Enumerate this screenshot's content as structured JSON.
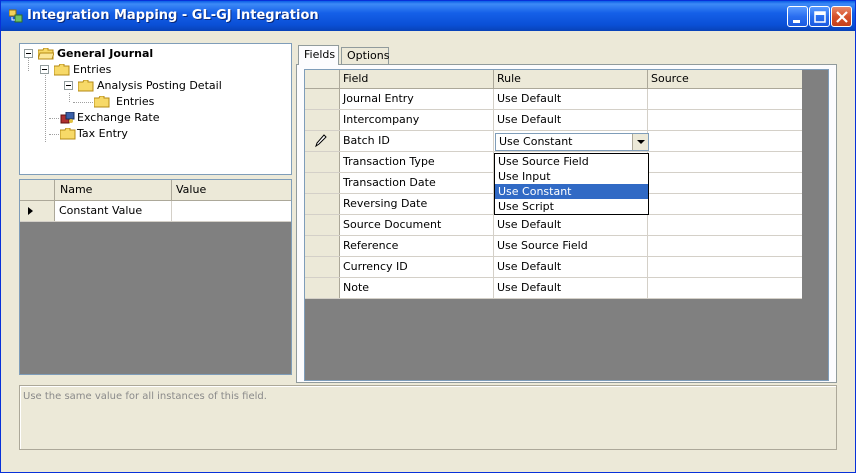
{
  "window": {
    "title": "Integration Mapping - GL-GJ Integration"
  },
  "tree": {
    "nodes": [
      {
        "label": "General Journal",
        "bold": true
      },
      {
        "label": "Entries"
      },
      {
        "label": "Analysis Posting Detail"
      },
      {
        "label": "Entries"
      },
      {
        "label": "Exchange Rate"
      },
      {
        "label": "Tax Entry"
      }
    ]
  },
  "properties": {
    "headers": {
      "name": "Name",
      "value": "Value"
    },
    "rows": [
      {
        "name": "Constant Value",
        "value": ""
      }
    ]
  },
  "tabs": [
    {
      "label": "Fields"
    },
    {
      "label": "Options"
    }
  ],
  "grid": {
    "headers": {
      "field": "Field",
      "rule": "Rule",
      "source": "Source"
    },
    "rows": [
      {
        "field": "Journal Entry",
        "rule": "Use Default",
        "source": ""
      },
      {
        "field": "Intercompany",
        "rule": "Use Default",
        "source": ""
      },
      {
        "field": "Batch ID",
        "rule": "Use Constant",
        "source": ""
      },
      {
        "field": "Transaction Type",
        "rule": "",
        "source": ""
      },
      {
        "field": "Transaction Date",
        "rule": "",
        "source": ""
      },
      {
        "field": "Reversing Date",
        "rule": "",
        "source": ""
      },
      {
        "field": "Source Document",
        "rule": "Use Default",
        "source": ""
      },
      {
        "field": "Reference",
        "rule": "Use Source Field",
        "source": ""
      },
      {
        "field": "Currency ID",
        "rule": "Use Default",
        "source": ""
      },
      {
        "field": "Note",
        "rule": "Use Default",
        "source": ""
      }
    ]
  },
  "rule_dropdown": {
    "options": [
      "Use Source Field",
      "Use Input",
      "Use Constant",
      "Use Script"
    ],
    "selected": "Use Constant"
  },
  "description": "Use the same value for all instances of this field.",
  "colors": {
    "titlebar": "#0a4fd6",
    "selection": "#316ac5",
    "grid_empty": "#808080"
  }
}
